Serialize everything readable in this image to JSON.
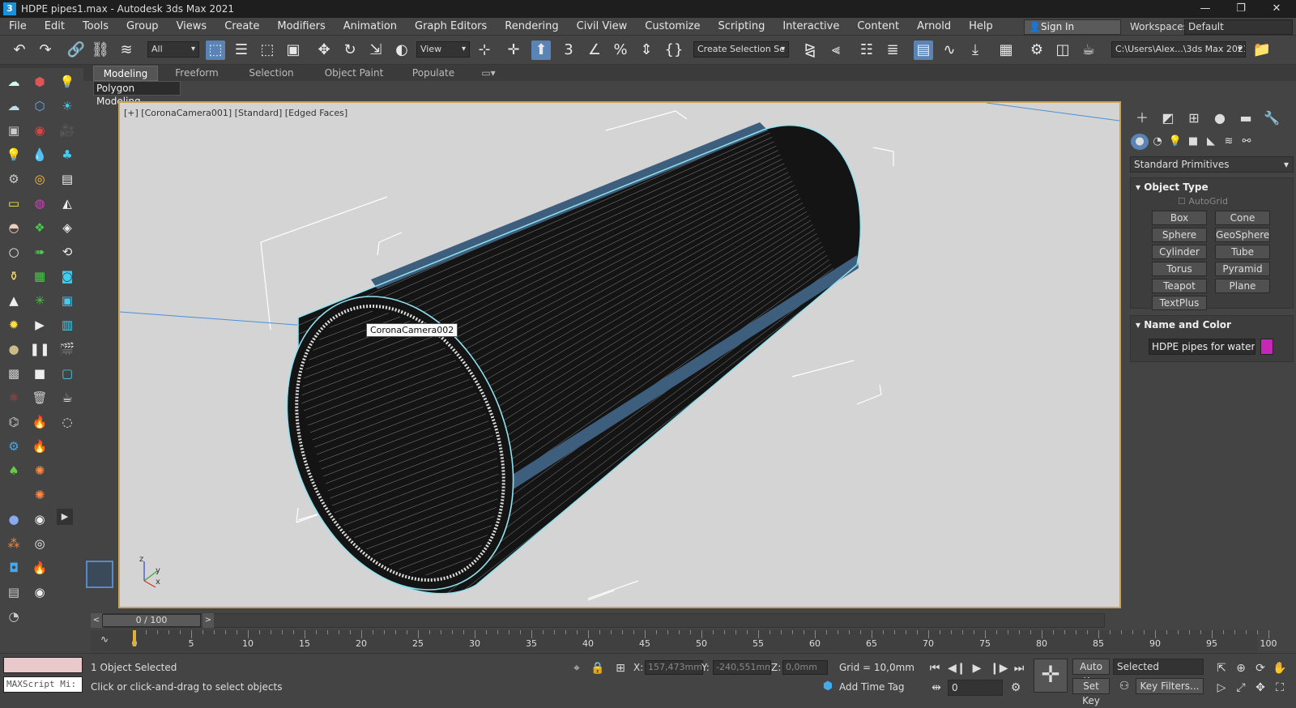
{
  "window": {
    "app_icon": "3",
    "title": "HDPE pipes1.max - Autodesk 3ds Max 2021",
    "minimize": "—",
    "maximize": "❐",
    "close": "✕"
  },
  "menu": [
    "File",
    "Edit",
    "Tools",
    "Group",
    "Views",
    "Create",
    "Modifiers",
    "Animation",
    "Graph Editors",
    "Rendering",
    "Civil View",
    "Customize",
    "Scripting",
    "Interactive",
    "Content",
    "Arnold",
    "Help"
  ],
  "account": {
    "sign_in": "Sign In",
    "workspaces_label": "Workspaces:",
    "workspace": "Default"
  },
  "toolbar": {
    "filter": "All",
    "ref_coord": "View",
    "selection_set": "Create Selection Se",
    "project_path": "C:\\Users\\Alex...\\3ds Max 2021"
  },
  "ribbon": {
    "tabs": [
      "Modeling",
      "Freeform",
      "Selection",
      "Object Paint",
      "Populate"
    ],
    "active_tab": "Modeling",
    "panel": "Polygon Modeling"
  },
  "viewport": {
    "label": "[+] [CoronaCamera001] [Standard] [Edged Faces]",
    "camera_tag": "CoronaCamera002",
    "axis_x": "x",
    "axis_y": "y",
    "axis_z": "z",
    "colors": {
      "background": "#d4d4d4",
      "pipe": "#141414",
      "stripe": "#3d5f7d",
      "highlight": "#8fe3f0"
    }
  },
  "command_panel": {
    "category": "Standard Primitives",
    "object_type": {
      "title": "Object Type",
      "autogrid": "AutoGrid",
      "buttons": [
        "Box",
        "Cone",
        "Sphere",
        "GeoSphere",
        "Cylinder",
        "Tube",
        "Torus",
        "Pyramid",
        "Teapot",
        "Plane",
        "TextPlus"
      ]
    },
    "name_and_color": {
      "title": "Name and Color",
      "name": "HDPE pipes for water supp",
      "color": "#c528b4"
    }
  },
  "timeline": {
    "frame_display": "0 / 100",
    "ticks": [
      "0",
      "5",
      "10",
      "15",
      "20",
      "25",
      "30",
      "35",
      "40",
      "45",
      "50",
      "55",
      "60",
      "65",
      "70",
      "75",
      "80",
      "85",
      "90",
      "95",
      "100"
    ]
  },
  "status": {
    "script_label": "MAXScript Mi:",
    "selection": "1 Object Selected",
    "prompt": "Click or click-and-drag to select objects",
    "x_label": "X:",
    "x": "157,473mm",
    "y_label": "Y:",
    "y": "-240,551mm",
    "z_label": "Z:",
    "z": "0,0mm",
    "grid": "Grid = 10,0mm",
    "add_time_tag": "Add Time Tag",
    "auto_key": "Auto K...",
    "set_key": "Set Key",
    "key_mode": "Selected",
    "key_filters": "Key Filters...",
    "current_frame": "0"
  }
}
